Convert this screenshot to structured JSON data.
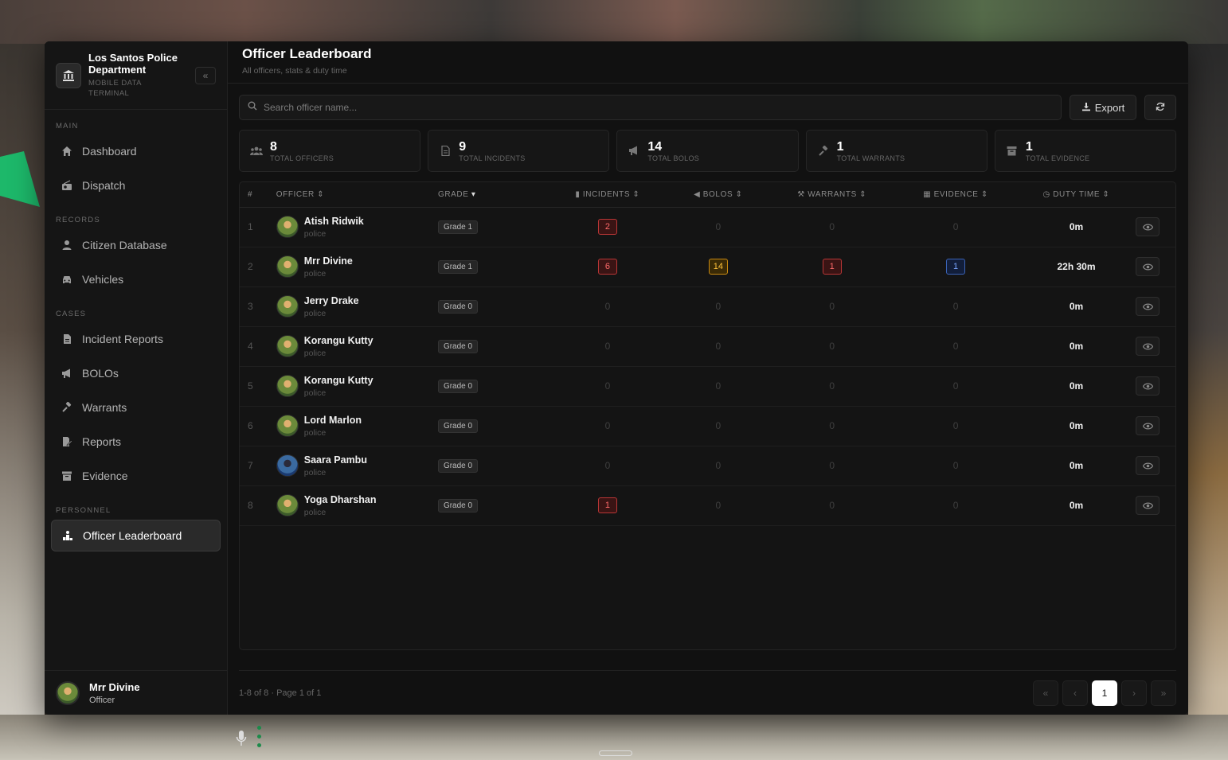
{
  "brand": {
    "title": "Los Santos Police Department",
    "subtitle": "MOBILE DATA TERMINAL"
  },
  "sidebar": {
    "sections": {
      "main": "MAIN",
      "records": "RECORDS",
      "cases": "CASES",
      "personnel": "PERSONNEL"
    },
    "items": [
      {
        "label": "Dashboard",
        "icon": "home-icon"
      },
      {
        "label": "Dispatch",
        "icon": "radio-icon"
      },
      {
        "label": "Citizen Database",
        "icon": "user-icon"
      },
      {
        "label": "Vehicles",
        "icon": "car-icon"
      },
      {
        "label": "Incident Reports",
        "icon": "file-icon"
      },
      {
        "label": "BOLOs",
        "icon": "megaphone-icon"
      },
      {
        "label": "Warrants",
        "icon": "gavel-icon"
      },
      {
        "label": "Reports",
        "icon": "file-edit-icon"
      },
      {
        "label": "Evidence",
        "icon": "archive-icon"
      },
      {
        "label": "Officer Leaderboard",
        "icon": "ranking-icon",
        "active": true
      }
    ]
  },
  "user": {
    "name": "Mrr Divine",
    "role": "Officer"
  },
  "header": {
    "title": "Officer Leaderboard",
    "subtitle": "All officers, stats & duty time"
  },
  "search": {
    "placeholder": "Search officer name..."
  },
  "toolbar": {
    "export_label": "Export"
  },
  "stats": [
    {
      "value": "8",
      "label": "TOTAL OFFICERS"
    },
    {
      "value": "9",
      "label": "TOTAL INCIDENTS"
    },
    {
      "value": "14",
      "label": "TOTAL BOLOS"
    },
    {
      "value": "1",
      "label": "TOTAL WARRANTS"
    },
    {
      "value": "1",
      "label": "TOTAL EVIDENCE"
    }
  ],
  "table": {
    "columns": {
      "idx": "#",
      "officer": "OFFICER",
      "grade": "GRADE",
      "incidents": "INCIDENTS",
      "bolos": "BOLOS",
      "warrants": "WARRANTS",
      "evidence": "EVIDENCE",
      "duty": "DUTY TIME"
    },
    "rows": [
      {
        "idx": "1",
        "name": "Atish Ridwik",
        "dept": "police",
        "grade": "Grade 1",
        "incidents": "2",
        "bolos": "0",
        "warrants": "0",
        "evidence": "0",
        "duty": "0m"
      },
      {
        "idx": "2",
        "name": "Mrr Divine",
        "dept": "police",
        "grade": "Grade 1",
        "incidents": "6",
        "bolos": "14",
        "warrants": "1",
        "evidence": "1",
        "duty": "22h 30m"
      },
      {
        "idx": "3",
        "name": "Jerry Drake",
        "dept": "police",
        "grade": "Grade 0",
        "incidents": "0",
        "bolos": "0",
        "warrants": "0",
        "evidence": "0",
        "duty": "0m"
      },
      {
        "idx": "4",
        "name": "Korangu Kutty",
        "dept": "police",
        "grade": "Grade 0",
        "incidents": "0",
        "bolos": "0",
        "warrants": "0",
        "evidence": "0",
        "duty": "0m"
      },
      {
        "idx": "5",
        "name": "Korangu Kutty",
        "dept": "police",
        "grade": "Grade 0",
        "incidents": "0",
        "bolos": "0",
        "warrants": "0",
        "evidence": "0",
        "duty": "0m"
      },
      {
        "idx": "6",
        "name": "Lord Marlon",
        "dept": "police",
        "grade": "Grade 0",
        "incidents": "0",
        "bolos": "0",
        "warrants": "0",
        "evidence": "0",
        "duty": "0m"
      },
      {
        "idx": "7",
        "name": "Saara Pambu",
        "dept": "police",
        "grade": "Grade 0",
        "incidents": "0",
        "bolos": "0",
        "warrants": "0",
        "evidence": "0",
        "duty": "0m"
      },
      {
        "idx": "8",
        "name": "Yoga Dharshan",
        "dept": "police",
        "grade": "Grade 0",
        "incidents": "1",
        "bolos": "0",
        "warrants": "0",
        "evidence": "0",
        "duty": "0m"
      }
    ]
  },
  "footer": {
    "info": "1-8 of 8 · Page 1 of 1",
    "current_page": "1"
  },
  "colors": {
    "accent_red": "#b93636",
    "accent_amber": "#c98a10",
    "accent_blue": "#3b63b8",
    "active_page": "#ffffff"
  }
}
